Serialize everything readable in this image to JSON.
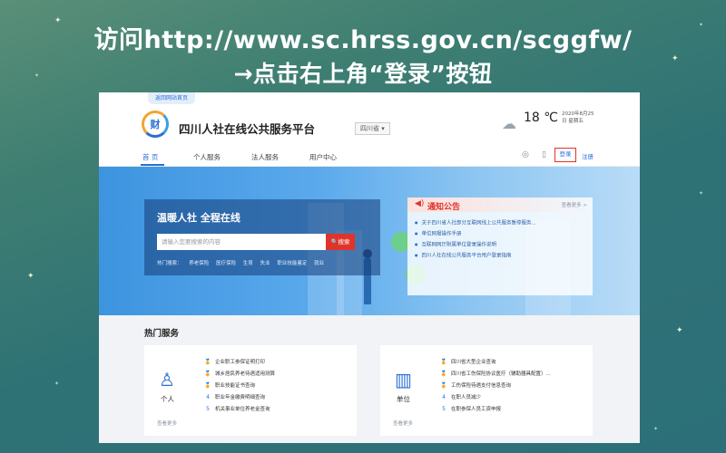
{
  "instructions": {
    "line1": "访问http://www.sc.hrss.gov.cn/scggfw/",
    "line2": "→点击右上角“登录”按钮"
  },
  "header": {
    "site_nav_badge": "返回网站首页",
    "logo_char": "财",
    "title": "四川人社在线公共服务平台",
    "province": "四川省 ▾",
    "weather_icon": "cloud-icon",
    "temperature": "18 ℃",
    "date": "2020年8月25日 星期五"
  },
  "nav": {
    "items": [
      "首 页",
      "个人服务",
      "法人服务",
      "用户中心"
    ],
    "login": "登录",
    "register": "注册"
  },
  "banner": {
    "heading": "温暖人社 全程在线",
    "search_placeholder": "请输入您要搜索的内容",
    "search_button": "搜索",
    "hot_search_label": "热门搜索：",
    "hot_search_items": [
      "养老保险",
      "医疗保险",
      "生育",
      "失业",
      "职业技能鉴定",
      "就业"
    ]
  },
  "notice": {
    "title": "通知公告",
    "more": "查看更多 >",
    "items": [
      "关于四川省人社部分互联网线上公共服务暂停服务...",
      "单位网报操作手册",
      "互联网网厅附属单位登录操作说明",
      "四川人社在线公共服务平台用户登录指南"
    ]
  },
  "hot_services": {
    "title": "热门服务",
    "cards": [
      {
        "label": "个人",
        "more": "查看更多",
        "items": [
          {
            "rank": "1",
            "text": "企业职工参保证明打印"
          },
          {
            "rank": "2",
            "text": "城乡居民养老待遇适用测算"
          },
          {
            "rank": "3",
            "text": "职业技能证书查询"
          },
          {
            "rank": "4",
            "text": "职业年金缴费明细查询"
          },
          {
            "rank": "5",
            "text": "机关事业单位养老金查询"
          }
        ]
      },
      {
        "label": "单位",
        "more": "查看更多",
        "items": [
          {
            "rank": "1",
            "text": "四川省大型企业查询"
          },
          {
            "rank": "2",
            "text": "四川省工伤保险协议医疗（辅助器具配置）..."
          },
          {
            "rank": "3",
            "text": "工伤保险待遇支付信息查询"
          },
          {
            "rank": "4",
            "text": "在职人员减少"
          },
          {
            "rank": "5",
            "text": "在职参保人员工资申报"
          }
        ]
      }
    ]
  }
}
